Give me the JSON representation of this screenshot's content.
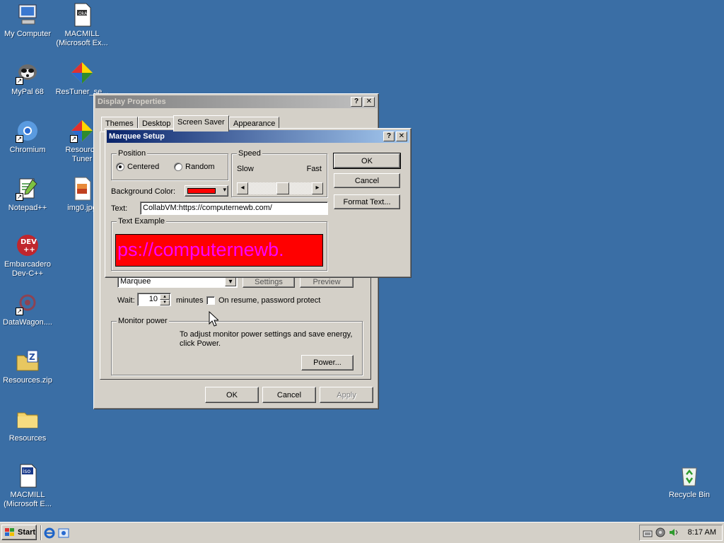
{
  "desktop": {
    "icons": [
      {
        "label": "My Computer",
        "icon": "my-computer-icon"
      },
      {
        "label": "MACMILL\n(Microsoft Ex...",
        "icon": "document-icon"
      },
      {
        "label": "MyPal 68",
        "icon": "raccoon-icon"
      },
      {
        "label": "ResTuner_se...",
        "icon": "restuner-icon"
      },
      {
        "label": "Chromium",
        "icon": "chromium-icon"
      },
      {
        "label": "Resource\nTuner",
        "icon": "restuner-icon"
      },
      {
        "label": "Notepad++",
        "icon": "notepad-icon"
      },
      {
        "label": "img0.jpg",
        "icon": "image-icon"
      },
      {
        "label": "Embarcadero\nDev-C++",
        "icon": "devcpp-icon"
      },
      {
        "label": "DataWagon....",
        "icon": "datawagon-icon"
      },
      {
        "label": "Resources.zip",
        "icon": "zip-icon"
      },
      {
        "label": "Resources",
        "icon": "folder-icon"
      },
      {
        "label": "MACMILL\n(Microsoft E...",
        "icon": "iso-icon"
      },
      {
        "label": "Recycle Bin",
        "icon": "recycle-bin-icon"
      }
    ]
  },
  "display_properties": {
    "title": "Display Properties",
    "tabs": [
      "Themes",
      "Desktop",
      "Screen Saver",
      "Appearance"
    ],
    "selected_tab": "Screen Saver",
    "screensaver_select": "Marquee",
    "settings_label": "Settings",
    "preview_label": "Preview",
    "wait_label": "Wait:",
    "wait_value": "10",
    "minutes_label": "minutes",
    "password_protect_label": "On resume, password protect",
    "monitor_power_legend": "Monitor power",
    "monitor_power_text": "To adjust monitor power settings and save energy, click Power.",
    "power_button": "Power...",
    "ok": "OK",
    "cancel": "Cancel",
    "apply": "Apply"
  },
  "marquee_setup": {
    "title": "Marquee Setup",
    "position_legend": "Position",
    "centered_label": "Centered",
    "random_label": "Random",
    "speed_legend": "Speed",
    "slow_label": "Slow",
    "fast_label": "Fast",
    "speed_level": 0.55,
    "bg_color_label": "Background Color:",
    "bg_color": "#ff0000",
    "text_label": "Text:",
    "text_value": "CollabVM:https://computernewb.com/",
    "text_example_legend": "Text Example",
    "text_example": "ps://computernewb.",
    "example_text_color": "#ff00ff",
    "ok": "OK",
    "cancel": "Cancel",
    "format_text": "Format Text..."
  },
  "taskbar": {
    "start_label": "Start",
    "clock": "8:17 AM"
  }
}
